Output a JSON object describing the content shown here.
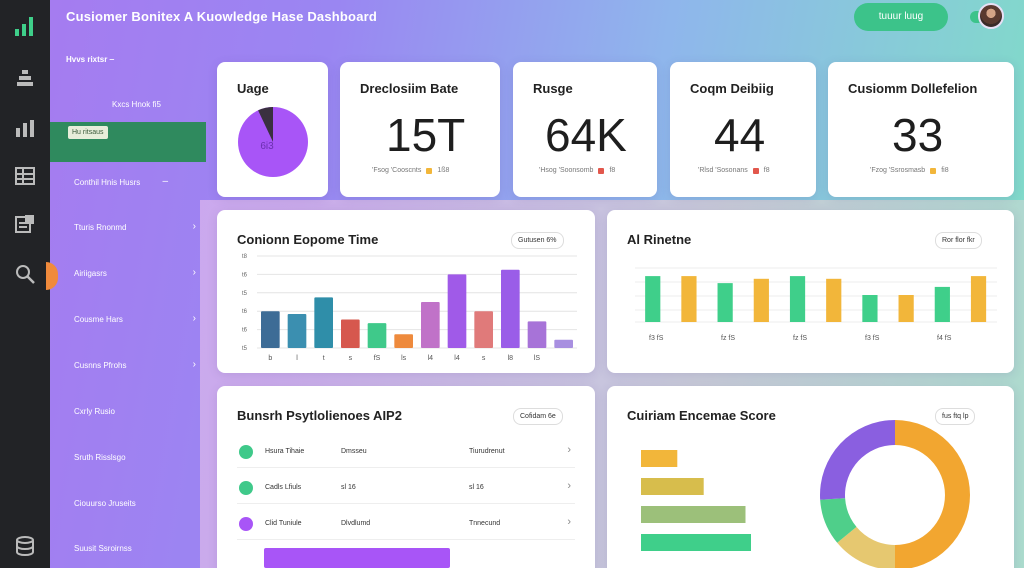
{
  "app": {
    "title": "Cusiomer Bonitex A Kuowledge Hase Dashboard",
    "top_button_label": "tuuur luug"
  },
  "rail": {
    "icons": [
      "chart-bars-icon",
      "stack-icon",
      "bar-chart-icon",
      "table-icon",
      "puzzle-icon",
      "search-icon",
      "database-icon"
    ]
  },
  "sidebar": {
    "header": "Hvvs rixtsr",
    "sub_label": "Kxcs Hnok fi5",
    "active_label": "Hu ritsaus",
    "items": [
      {
        "label": "Conthil Hnis Husrs"
      },
      {
        "label": "Tturis Rnonmd"
      },
      {
        "label": "Airiigasrs"
      },
      {
        "label": "Cousme Hars"
      },
      {
        "label": "Cusnns Pfrohs"
      },
      {
        "label": "Cxrly Rusio"
      },
      {
        "label": "Sruth Risslsgo"
      },
      {
        "label": "Ciouurso Jruseits"
      },
      {
        "label": "Suusit Ssroirnss"
      }
    ]
  },
  "stats": [
    {
      "title": "Uage",
      "value": "",
      "foot_text": "",
      "foot_value": "",
      "foot_color": ""
    },
    {
      "title": "Dreclosiim Bate",
      "value": "15T",
      "foot_text": "'Fsog 'Cooscnts",
      "foot_value": "1ß8",
      "foot_color": "#f2b63a"
    },
    {
      "title": "Rusge",
      "value": "64K",
      "foot_text": "'Hsog 'Soonsomb",
      "foot_value": "f8",
      "foot_color": "#e2574c"
    },
    {
      "title": "Coqm Deibiig",
      "value": "44",
      "foot_text": "'Rlsd 'Sosonans",
      "foot_value": "f8",
      "foot_color": "#e2574c"
    },
    {
      "title": "Cusiomm Dollefelion",
      "value": "33",
      "foot_text": "'Fzog 'Ssrosmasb",
      "foot_value": "fi8",
      "foot_color": "#f2b63a"
    }
  ],
  "pie_card": {
    "label": "6i3",
    "fraction": 0.93,
    "color": "#a855f7",
    "slice_color": "#3a3040"
  },
  "resolution_chart": {
    "title": "Conionn Eopome Time",
    "badge": "Gutusen 6%",
    "ytick_labels": [
      "t5",
      "t6",
      "t6",
      "t5",
      "t6",
      "t8"
    ],
    "xtick_labels": [
      "b",
      "l",
      "t",
      "s",
      "fS",
      "ls",
      "l4",
      "l4",
      "s",
      "l8",
      "lS"
    ]
  },
  "chart_data": {
    "type": "bar",
    "title": "Conionn Eopome Time",
    "categories": [
      "b",
      "l",
      "t",
      "s",
      "fS",
      "ls",
      "l4",
      "l4",
      "s",
      "l8",
      "lS"
    ],
    "values": [
      40,
      37,
      55,
      31,
      27,
      15,
      50,
      80,
      40,
      85,
      29,
      9
    ],
    "colors": [
      "#3d6c96",
      "#3b8fb0",
      "#2f8ea9",
      "#d6584e",
      "#3fc98a",
      "#ee8a3d",
      "#c072c8",
      "#a05ae8",
      "#e07a7a",
      "#9a5de8",
      "#a773d8",
      "#a88fe0"
    ],
    "ylim": [
      0,
      100
    ]
  },
  "ai_chart": {
    "title": "Al Rinetne",
    "badge": "Ror flor fkr",
    "xtick_labels": [
      "f3 fS",
      "fz fS",
      "fz fS",
      "f3 fS",
      "f4 fS"
    ],
    "chart_data": {
      "type": "bar",
      "values": [
        0.85,
        0.85,
        0.72,
        0.8,
        0.85,
        0.8,
        0.5,
        0.5,
        0.65,
        0.85
      ],
      "colors": [
        "#3fcf8a",
        "#f2b63a",
        "#3fcf8a",
        "#f2b63a",
        "#3fcf8a",
        "#f2b63a",
        "#3fcf8a",
        "#f2b63a",
        "#3fcf8a",
        "#f2b63a"
      ]
    }
  },
  "ticket_table": {
    "title": "Bunsrh Psytlolienoes AIP2",
    "badge": "Cofidam 6e",
    "rows": [
      {
        "c1": "Hsura Tihaie",
        "c2": "Dmsseu",
        "c3": "Tiurudrenut",
        "dot": "#3fc98a"
      },
      {
        "c1": "Cadls Lfiuls",
        "c2": "sl 16",
        "c3": "sl 16",
        "dot": "#3fc98a"
      },
      {
        "c1": "Clid Tuniule",
        "c2": "Dlvdlumd",
        "c3": "Tnnecund",
        "dot": "#a855f7"
      }
    ],
    "progress_fraction": 0.55
  },
  "score_card": {
    "title": "Cuiriam Encemae Score",
    "badge": "fus ftq lp",
    "bars": [
      {
        "fraction": 0.33,
        "color": "#f2b63a"
      },
      {
        "fraction": 0.57,
        "color": "#d7bd4c"
      },
      {
        "fraction": 0.95,
        "color": "#9cc07a"
      },
      {
        "fraction": 1.0,
        "color": "#3fcf8a"
      }
    ],
    "donut": [
      {
        "fraction": 0.5,
        "color": "#f2a630"
      },
      {
        "fraction": 0.14,
        "color": "#e6c870"
      },
      {
        "fraction": 0.1,
        "color": "#4fcf8a"
      },
      {
        "fraction": 0.26,
        "color": "#8a5fe0"
      }
    ]
  }
}
